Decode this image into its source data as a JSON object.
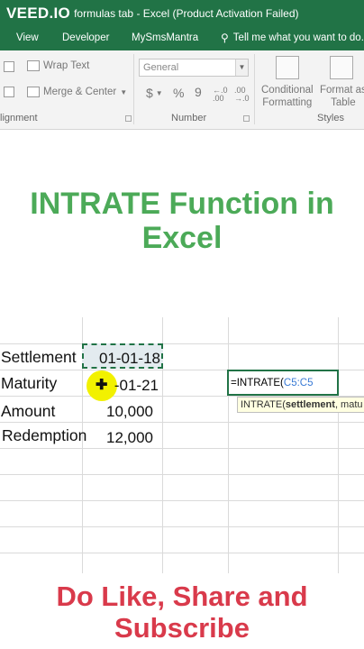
{
  "titlebar": {
    "logo": "VEED.IO",
    "title": "formulas tab - Excel (Product Activation Failed)"
  },
  "menu": {
    "items": [
      "View",
      "Developer",
      "MySmsMantra"
    ],
    "tell_me": "Tell me what you want to do..."
  },
  "ribbon": {
    "wrap_text": "Wrap Text",
    "merge_center": "Merge & Center",
    "alignment_label": "lignment",
    "number_format_value": "General",
    "currency_symbol": "$",
    "percent_symbol": "%",
    "comma_symbol": "9",
    "number_label": "Number",
    "conditional_line1": "Conditional",
    "conditional_line2": "Formatting",
    "format_as_line1": "Format as",
    "format_as_line2": "Table",
    "styles_label": "Styles"
  },
  "headline": {
    "line1": "INTRATE Function in",
    "line2": "Excel"
  },
  "sheet": {
    "labels": [
      "Settlement",
      "Maturity",
      "Amount",
      "Redemption"
    ],
    "values": [
      "01-01-18",
      "-01-21",
      "10,000",
      "12,000"
    ],
    "formula_prefix": "=INTRATE(",
    "formula_ref": "C5:C5",
    "tooltip_prefix": "INTRATE(",
    "tooltip_arg": "settlement",
    "tooltip_rest": ", matu"
  },
  "footer": {
    "line1": "Do Like, Share and",
    "line2": "Subscribe"
  },
  "colors": {
    "excel_green": "#217346",
    "headline_green": "#4caa58",
    "footer_red": "#d93a4b",
    "cursor_yellow": "#f2f100"
  }
}
